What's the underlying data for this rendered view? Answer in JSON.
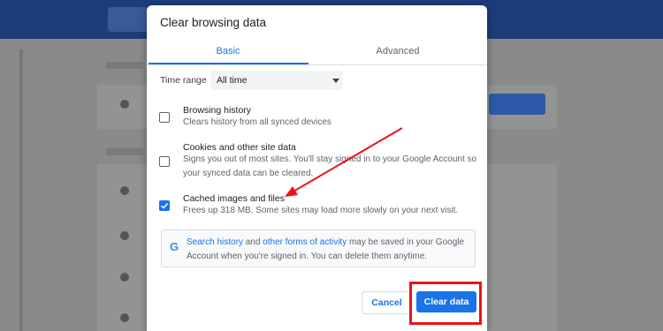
{
  "dialog": {
    "title": "Clear browsing data",
    "tabs": [
      {
        "label": "Basic",
        "active": true
      },
      {
        "label": "Advanced",
        "active": false
      }
    ],
    "time_range": {
      "label": "Time range",
      "value": "All time"
    },
    "options": [
      {
        "title": "Browsing history",
        "description": "Clears history from all synced devices",
        "checked": false
      },
      {
        "title": "Cookies and other site data",
        "description": "Signs you out of most sites. You'll stay signed in to your Google Account so your synced data can be cleared.",
        "checked": false
      },
      {
        "title": "Cached images and files",
        "description": "Frees up 318 MB. Some sites may load more slowly on your next visit.",
        "checked": true
      }
    ],
    "info": {
      "link1": "Search history",
      "text1": " and ",
      "link2": "other forms of activity",
      "text2": " may be saved in your Google Account when you're signed in. You can delete them anytime."
    },
    "buttons": {
      "cancel": "Cancel",
      "clear": "Clear data"
    }
  },
  "colors": {
    "accent": "#1a73e8",
    "annotation": "#e8141a"
  }
}
